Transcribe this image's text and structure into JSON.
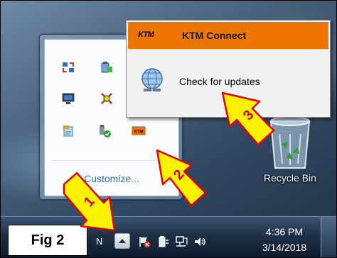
{
  "tray_panel": {
    "icons": [
      "network-sync-icon",
      "battery-monitor-icon",
      "display-icon",
      "antivirus-icon",
      "notepad-app-icon",
      "usb-safe-remove-icon",
      "ktm-tray-icon"
    ],
    "customize_label": "Customize..."
  },
  "context_menu": {
    "items": [
      {
        "logo": "KTM",
        "label": "KTM Connect",
        "highlighted": true
      },
      {
        "label": "Check for updates",
        "highlighted": false
      }
    ],
    "highlight_color": "#ee7600"
  },
  "desktop": {
    "recycle_bin_label": "Recycle Bin"
  },
  "taskbar": {
    "language": "N",
    "clock_time": "4:36 PM",
    "clock_date": "3/14/2018",
    "tray_icons": [
      "show-hidden-icons-button",
      "action-center-flag-icon",
      "power-icon",
      "network-icon",
      "volume-icon"
    ]
  },
  "figure_label": "Fig 2",
  "callouts": [
    {
      "number": "1",
      "target": "show-hidden-icons-button"
    },
    {
      "number": "2",
      "target": "ktm-tray-icon"
    },
    {
      "number": "3",
      "target": "check-for-updates"
    }
  ],
  "colors": {
    "arrow_fill": "#fff200",
    "arrow_stroke": "#e00000",
    "number_color": "#d40000"
  }
}
